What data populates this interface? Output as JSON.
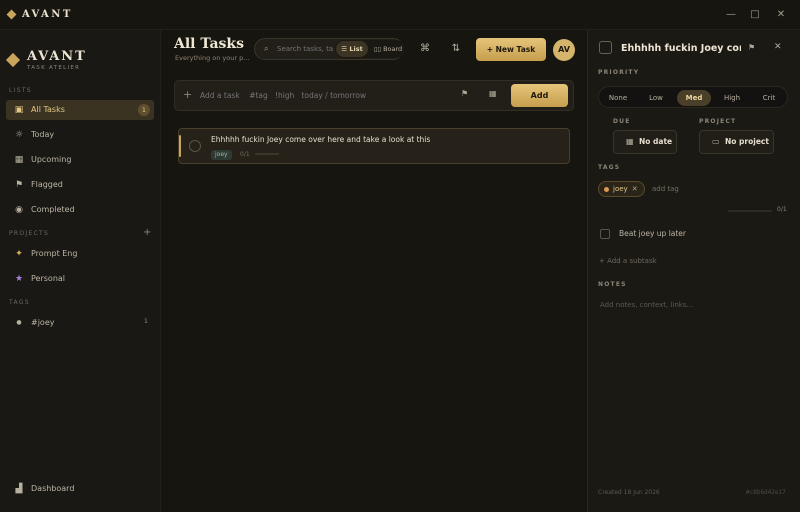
{
  "titlebar": {
    "app_name": "AVANT",
    "min": "—",
    "max": "□",
    "close": "✕"
  },
  "brand": {
    "name": "AVANT",
    "subtitle": "TASK ATELIER"
  },
  "sidebar": {
    "lists_label": "LISTS",
    "lists": [
      {
        "label": "All Tasks",
        "count": "1",
        "icon": "inbox-icon"
      },
      {
        "label": "Today",
        "icon": "sun-icon"
      },
      {
        "label": "Upcoming",
        "icon": "calendar-icon"
      },
      {
        "label": "Flagged",
        "icon": "flag-icon"
      },
      {
        "label": "Completed",
        "icon": "check-circle-icon"
      }
    ],
    "projects_label": "PROJECTS",
    "projects": [
      {
        "label": "Prompt Eng",
        "icon": "sparkle-icon",
        "color": "#e0b35a"
      },
      {
        "label": "Personal",
        "icon": "star-icon",
        "color": "#a97fd6"
      }
    ],
    "tags_label": "TAGS",
    "tags": [
      {
        "label": "#joey",
        "count": "1"
      }
    ],
    "dashboard_label": "Dashboard"
  },
  "main": {
    "title": "All Tasks",
    "subtitle": "Everything on your p...",
    "search_placeholder": "Search tasks, ta",
    "view_list": "List",
    "view_board": "Board",
    "new_task": "New Task",
    "avatar": "AV",
    "add_placeholder": "Add a task    #tag   !high   today / tomorrow",
    "add_button": "Add",
    "tasks": [
      {
        "title": "Ehhhhh fuckin Joey come over here and take a look at this",
        "tag": "joey",
        "progress": "0/1"
      }
    ]
  },
  "panel": {
    "title": "Ehhhhh fuckin Joey con",
    "priority_label": "PRIORITY",
    "priorities": [
      "None",
      "Low",
      "Med",
      "High",
      "Crit"
    ],
    "priority_selected": "Med",
    "due_label": "DUE",
    "due_value": "No date",
    "project_label": "PROJECT",
    "project_value": "No project",
    "tags_label": "TAGS",
    "tag": "joey",
    "add_tag": "add tag",
    "subtask_count": "0/1",
    "subtask": "Beat joey up later",
    "add_subtask": "+ Add a subtask",
    "notes_label": "NOTES",
    "notes_placeholder": "Add notes, context, links...",
    "created": "Created 18 Jun 2026",
    "hash": "#c8b6d42e17"
  },
  "colors": {
    "accent": "#c9a45a",
    "background": "#14120f"
  }
}
